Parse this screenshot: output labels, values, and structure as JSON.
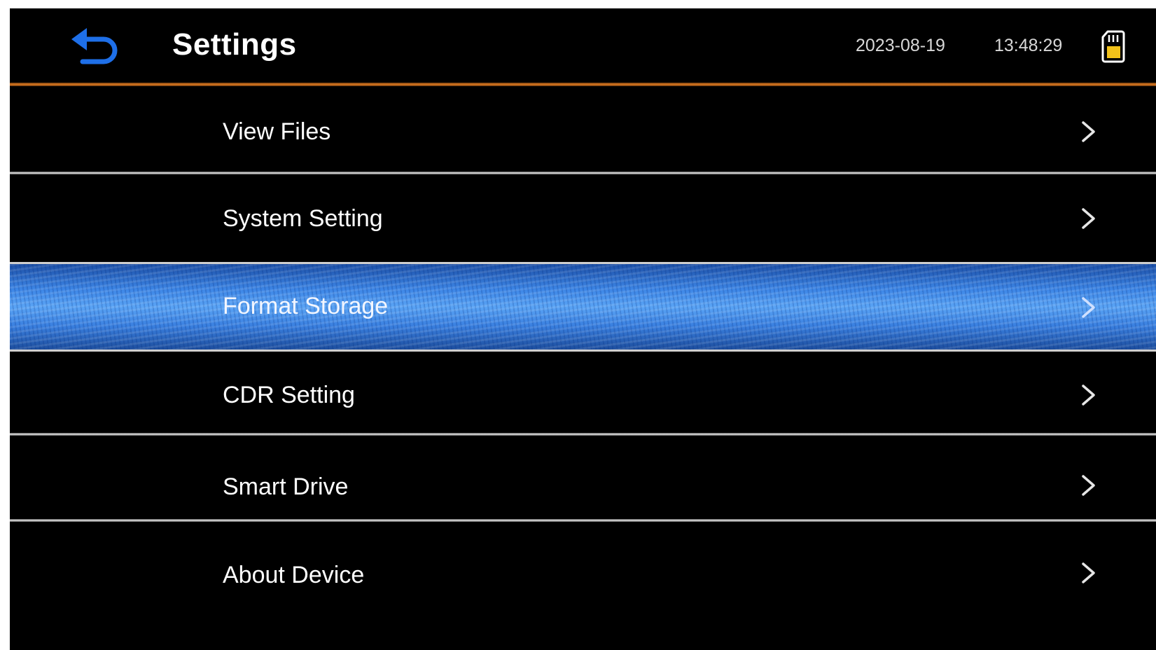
{
  "header": {
    "title": "Settings",
    "date": "2023-08-19",
    "time": "13:48:29",
    "back_icon": "back-arrow-icon",
    "storage_icon": "sd-card-icon"
  },
  "colors": {
    "background": "#000000",
    "accent_line": "#e07a20",
    "selected_row": "#3d86e6",
    "back_icon": "#1e6fe8",
    "sd_icon": "#f2c21a",
    "text": "#ffffff"
  },
  "menu": {
    "selected_index": 2,
    "items": [
      {
        "label": "View Files",
        "icon": "chevron-right-icon"
      },
      {
        "label": "System Setting",
        "icon": "chevron-right-icon"
      },
      {
        "label": "Format Storage",
        "icon": "chevron-right-icon"
      },
      {
        "label": "CDR Setting",
        "icon": "chevron-right-icon"
      },
      {
        "label": "Smart Drive",
        "icon": "chevron-right-icon"
      },
      {
        "label": "About Device",
        "icon": "chevron-right-icon"
      }
    ]
  }
}
